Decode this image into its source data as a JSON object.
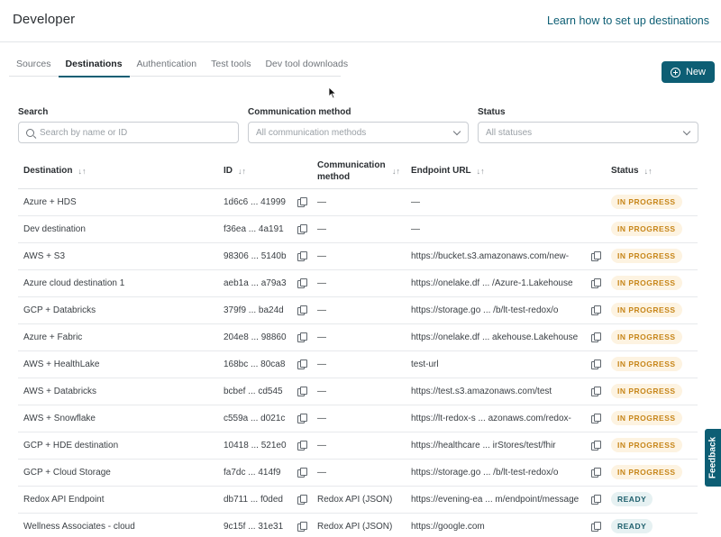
{
  "header": {
    "title": "Developer",
    "help_link": "Learn how to set up destinations"
  },
  "tabs": [
    {
      "label": "Sources"
    },
    {
      "label": "Destinations"
    },
    {
      "label": "Authentication"
    },
    {
      "label": "Test tools"
    },
    {
      "label": "Dev tool downloads"
    }
  ],
  "new_button": {
    "label": "New",
    "icon": "plus-circle-icon"
  },
  "filters": {
    "search": {
      "label": "Search",
      "placeholder": "Search by name or ID"
    },
    "method": {
      "label": "Communication method",
      "placeholder": "All communication methods"
    },
    "status": {
      "label": "Status",
      "placeholder": "All statuses"
    }
  },
  "table": {
    "columns": {
      "destination": "Destination",
      "id": "ID",
      "method_line1": "Communication",
      "method_line2": "method",
      "endpoint": "Endpoint URL",
      "status": "Status"
    },
    "sort_glyph": "↓↑",
    "rows": [
      {
        "name": "Azure + HDS",
        "id": "1d6c6 ... 41999",
        "method": "—",
        "endpoint": "—",
        "status": "IN PROGRESS"
      },
      {
        "name": "Dev destination",
        "id": "f36ea ... 4a191",
        "method": "—",
        "endpoint": "—",
        "status": "IN PROGRESS"
      },
      {
        "name": "AWS + S3",
        "id": "98306 ... 5140b",
        "method": "—",
        "endpoint": "https://bucket.s3.amazonaws.com/new-",
        "status": "IN PROGRESS"
      },
      {
        "name": "Azure cloud destination 1",
        "id": "aeb1a ... a79a3",
        "method": "—",
        "endpoint": "https://onelake.df ... /Azure-1.Lakehouse",
        "status": "IN PROGRESS"
      },
      {
        "name": "GCP + Databricks",
        "id": "379f9 ... ba24d",
        "method": "—",
        "endpoint": "https://storage.go ... /b/lt-test-redox/o",
        "status": "IN PROGRESS"
      },
      {
        "name": "Azure + Fabric",
        "id": "204e8 ... 98860",
        "method": "—",
        "endpoint": "https://onelake.df ... akehouse.Lakehouse",
        "status": "IN PROGRESS"
      },
      {
        "name": "AWS + HealthLake",
        "id": "168bc ... 80ca8",
        "method": "—",
        "endpoint": "test-url",
        "status": "IN PROGRESS"
      },
      {
        "name": "AWS + Databricks",
        "id": "bcbef ... cd545",
        "method": "—",
        "endpoint": "https://test.s3.amazonaws.com/test",
        "status": "IN PROGRESS"
      },
      {
        "name": "AWS + Snowflake",
        "id": "c559a ... d021c",
        "method": "—",
        "endpoint": "https://lt-redox-s ... azonaws.com/redox-",
        "status": "IN PROGRESS"
      },
      {
        "name": "GCP + HDE destination",
        "id": "10418 ... 521e0",
        "method": "—",
        "endpoint": "https://healthcare ... irStores/test/fhir",
        "status": "IN PROGRESS"
      },
      {
        "name": "GCP + Cloud Storage",
        "id": "fa7dc ... 414f9",
        "method": "—",
        "endpoint": "https://storage.go ... /b/lt-test-redox/o",
        "status": "IN PROGRESS"
      },
      {
        "name": "Redox API Endpoint",
        "id": "db711 ... f0ded",
        "method": "Redox API (JSON)",
        "endpoint": "https://evening-ea ... m/endpoint/message",
        "status": "READY"
      },
      {
        "name": "Wellness Associates - cloud",
        "id": "9c15f ... 31e31",
        "method": "Redox API (JSON)",
        "endpoint": "https://google.com",
        "status": "READY"
      }
    ]
  },
  "feedback": {
    "label": "Feedback"
  },
  "colors": {
    "accent": "#0d5e74",
    "in_progress_text": "#c7861a",
    "in_progress_bg": "#fdf3e1",
    "ready_text": "#1e5f6c",
    "ready_bg": "#e6f1f2"
  }
}
